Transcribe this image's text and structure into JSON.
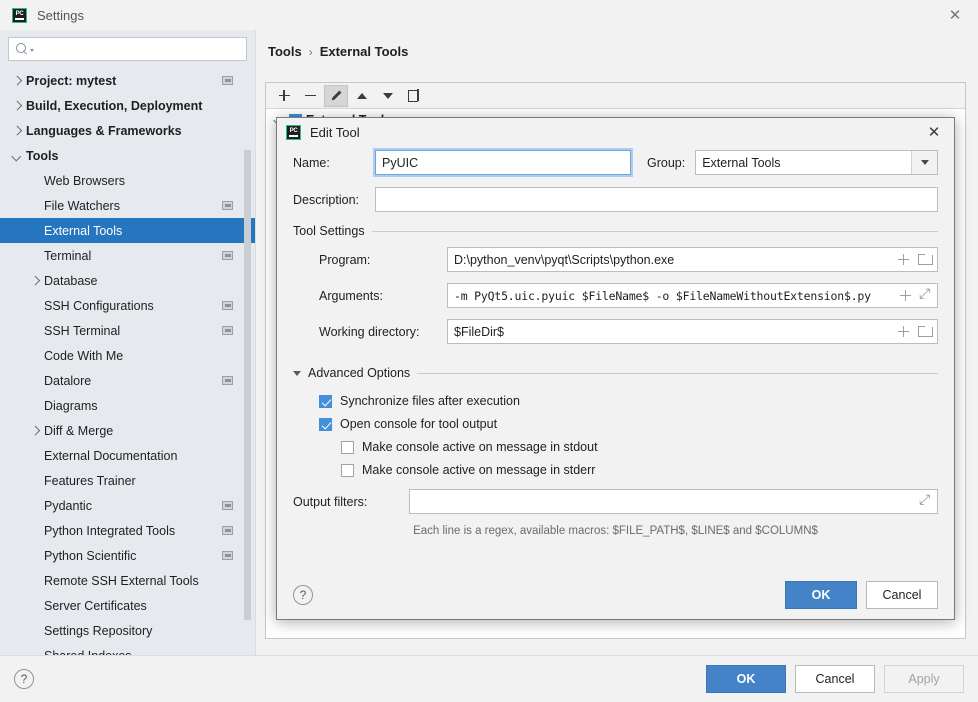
{
  "window": {
    "title": "Settings",
    "close_label": "✕",
    "app_icon": "pycharm-icon"
  },
  "sidebar": {
    "search": {
      "value": "",
      "placeholder": ""
    },
    "items": [
      {
        "label": "Project: mytest",
        "level": 0,
        "arrow": "right",
        "bold": true,
        "badge": true,
        "selected": false
      },
      {
        "label": "Build, Execution, Deployment",
        "level": 0,
        "arrow": "right",
        "bold": true,
        "badge": false,
        "selected": false
      },
      {
        "label": "Languages & Frameworks",
        "level": 0,
        "arrow": "right",
        "bold": true,
        "badge": false,
        "selected": false
      },
      {
        "label": "Tools",
        "level": 0,
        "arrow": "down",
        "bold": true,
        "badge": false,
        "selected": false
      },
      {
        "label": "Web Browsers",
        "level": 1,
        "arrow": "none",
        "bold": false,
        "badge": false,
        "selected": false
      },
      {
        "label": "File Watchers",
        "level": 1,
        "arrow": "none",
        "bold": false,
        "badge": true,
        "selected": false
      },
      {
        "label": "External Tools",
        "level": 1,
        "arrow": "none",
        "bold": false,
        "badge": false,
        "selected": true
      },
      {
        "label": "Terminal",
        "level": 1,
        "arrow": "none",
        "bold": false,
        "badge": true,
        "selected": false
      },
      {
        "label": "Database",
        "level": 1,
        "arrow": "right",
        "bold": false,
        "badge": false,
        "selected": false
      },
      {
        "label": "SSH Configurations",
        "level": 1,
        "arrow": "none",
        "bold": false,
        "badge": true,
        "selected": false
      },
      {
        "label": "SSH Terminal",
        "level": 1,
        "arrow": "none",
        "bold": false,
        "badge": true,
        "selected": false
      },
      {
        "label": "Code With Me",
        "level": 1,
        "arrow": "none",
        "bold": false,
        "badge": false,
        "selected": false
      },
      {
        "label": "Datalore",
        "level": 1,
        "arrow": "none",
        "bold": false,
        "badge": true,
        "selected": false
      },
      {
        "label": "Diagrams",
        "level": 1,
        "arrow": "none",
        "bold": false,
        "badge": false,
        "selected": false
      },
      {
        "label": "Diff & Merge",
        "level": 1,
        "arrow": "right",
        "bold": false,
        "badge": false,
        "selected": false
      },
      {
        "label": "External Documentation",
        "level": 1,
        "arrow": "none",
        "bold": false,
        "badge": false,
        "selected": false
      },
      {
        "label": "Features Trainer",
        "level": 1,
        "arrow": "none",
        "bold": false,
        "badge": false,
        "selected": false
      },
      {
        "label": "Pydantic",
        "level": 1,
        "arrow": "none",
        "bold": false,
        "badge": true,
        "selected": false
      },
      {
        "label": "Python Integrated Tools",
        "level": 1,
        "arrow": "none",
        "bold": false,
        "badge": true,
        "selected": false
      },
      {
        "label": "Python Scientific",
        "level": 1,
        "arrow": "none",
        "bold": false,
        "badge": true,
        "selected": false
      },
      {
        "label": "Remote SSH External Tools",
        "level": 1,
        "arrow": "none",
        "bold": false,
        "badge": false,
        "selected": false
      },
      {
        "label": "Server Certificates",
        "level": 1,
        "arrow": "none",
        "bold": false,
        "badge": false,
        "selected": false
      },
      {
        "label": "Settings Repository",
        "level": 1,
        "arrow": "none",
        "bold": false,
        "badge": false,
        "selected": false
      },
      {
        "label": "Shared Indexes",
        "level": 1,
        "arrow": "none",
        "bold": false,
        "badge": false,
        "selected": false
      }
    ]
  },
  "breadcrumb": {
    "parent": "Tools",
    "separator": "›",
    "current": "External Tools"
  },
  "tool_panel": {
    "toolbar": [
      {
        "name": "add",
        "glyph": "+"
      },
      {
        "name": "remove",
        "glyph": "−"
      },
      {
        "name": "edit",
        "glyph": "✎"
      },
      {
        "name": "move-up",
        "glyph": "▲"
      },
      {
        "name": "move-down",
        "glyph": "▼"
      },
      {
        "name": "copy",
        "glyph": "⧉"
      }
    ],
    "group_node": "External Tools"
  },
  "dialog": {
    "title": "Edit Tool",
    "close_label": "✕",
    "name": {
      "label": "Name:",
      "value": "PyUIC"
    },
    "group": {
      "label": "Group:",
      "value": "External Tools"
    },
    "description": {
      "label": "Description:",
      "value": ""
    },
    "tool_settings": {
      "legend": "Tool Settings",
      "program": {
        "label": "Program:",
        "value": "D:\\python_venv\\pyqt\\Scripts\\python.exe"
      },
      "arguments": {
        "label": "Arguments:",
        "value": "-m PyQt5.uic.pyuic $FileName$ -o $FileNameWithoutExtension$.py"
      },
      "workdir": {
        "label": "Working directory:",
        "value": "$FileDir$"
      }
    },
    "advanced": {
      "legend": "Advanced Options",
      "checkboxes": [
        {
          "label": "Synchronize files after execution",
          "checked": true,
          "indent": 0
        },
        {
          "label": "Open console for tool output",
          "checked": true,
          "indent": 0
        },
        {
          "label": "Make console active on message in stdout",
          "checked": false,
          "indent": 1
        },
        {
          "label": "Make console active on message in stderr",
          "checked": false,
          "indent": 1
        }
      ],
      "output_filters": {
        "label": "Output filters:",
        "value": ""
      },
      "hint": "Each line is a regex, available macros: $FILE_PATH$, $LINE$ and $COLUMN$"
    },
    "footer": {
      "help": "?",
      "ok": "OK",
      "cancel": "Cancel"
    }
  },
  "settings_footer": {
    "help": "?",
    "ok": "OK",
    "cancel": "Cancel",
    "apply": "Apply"
  },
  "colors": {
    "accent_blue": "#2675bf",
    "button_blue": "#4483c7",
    "checkbox_blue": "#4390d8",
    "sidebar_bg": "#e6eaee",
    "panel_bg": "#f2f2f2"
  }
}
